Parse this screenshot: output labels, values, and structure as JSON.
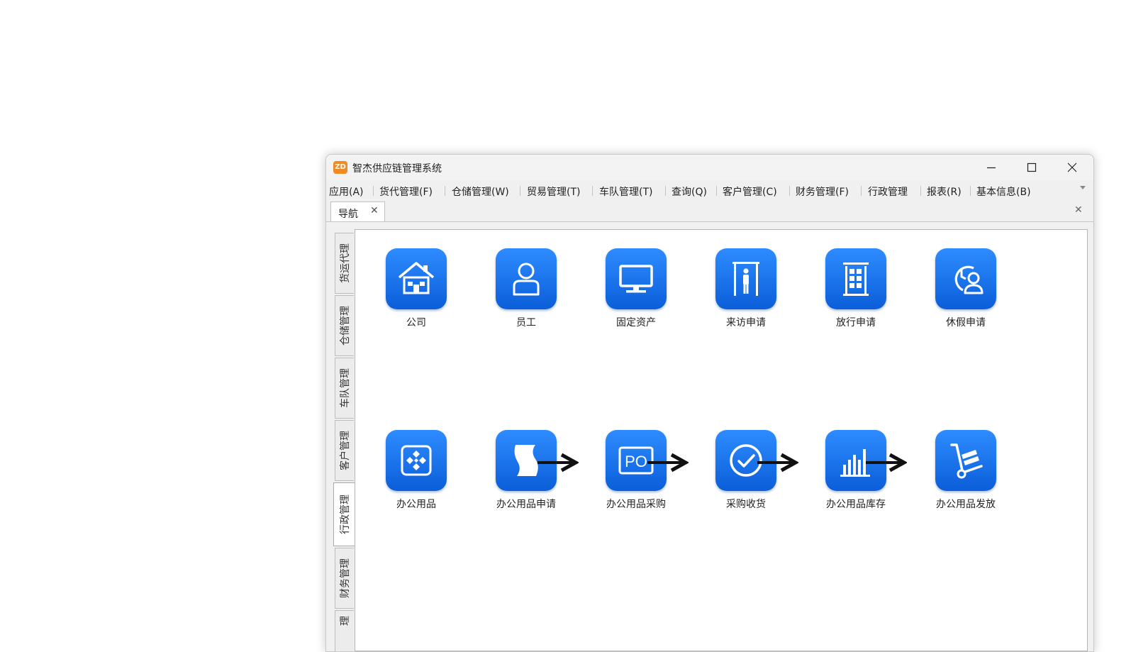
{
  "window": {
    "title": "智杰供应链管理系统",
    "app_icon_text": "ZD"
  },
  "menubar": {
    "items": [
      {
        "label": "应用(A)"
      },
      {
        "label": "货代管理(F)"
      },
      {
        "label": "仓储管理(W)"
      },
      {
        "label": "贸易管理(T)"
      },
      {
        "label": "车队管理(T)"
      },
      {
        "label": "查询(Q)"
      },
      {
        "label": "客户管理(C)"
      },
      {
        "label": "财务管理(F)"
      },
      {
        "label": "行政管理"
      },
      {
        "label": "报表(R)"
      },
      {
        "label": "基本信息(B)"
      }
    ]
  },
  "doc_tab": {
    "label": "导航",
    "close": "✕"
  },
  "panel_close": "✕",
  "side_tabs": [
    {
      "label": "货运代理",
      "active": false
    },
    {
      "label": "仓储管理",
      "active": false
    },
    {
      "label": "车队管理",
      "active": false
    },
    {
      "label": "客户管理",
      "active": false
    },
    {
      "label": "行政管理",
      "active": true
    },
    {
      "label": "财务管理",
      "active": false
    },
    {
      "label": "理",
      "active": false
    }
  ],
  "tiles_row1": [
    {
      "label": "公司",
      "icon": "house-icon"
    },
    {
      "label": "员工",
      "icon": "person-icon"
    },
    {
      "label": "固定资产",
      "icon": "monitor-icon"
    },
    {
      "label": "来访申请",
      "icon": "visitor-gate-icon"
    },
    {
      "label": "放行申请",
      "icon": "building-icon"
    },
    {
      "label": "休假申请",
      "icon": "clock-person-icon"
    }
  ],
  "tiles_row2": [
    {
      "label": "办公用品",
      "icon": "diamond-grid-icon"
    },
    {
      "label": "办公用品申请",
      "icon": "paper-icon"
    },
    {
      "label": "办公用品采购",
      "icon": "po-icon",
      "icon_text": "PO"
    },
    {
      "label": "采购收货",
      "icon": "check-circle-icon"
    },
    {
      "label": "办公用品库存",
      "icon": "bar-chart-icon"
    },
    {
      "label": "办公用品发放",
      "icon": "hand-truck-icon"
    }
  ],
  "colors": {
    "tile_blue_top": "#2e8cff",
    "tile_blue_bottom": "#0b5ed9",
    "app_icon_orange": "#f08a24"
  }
}
